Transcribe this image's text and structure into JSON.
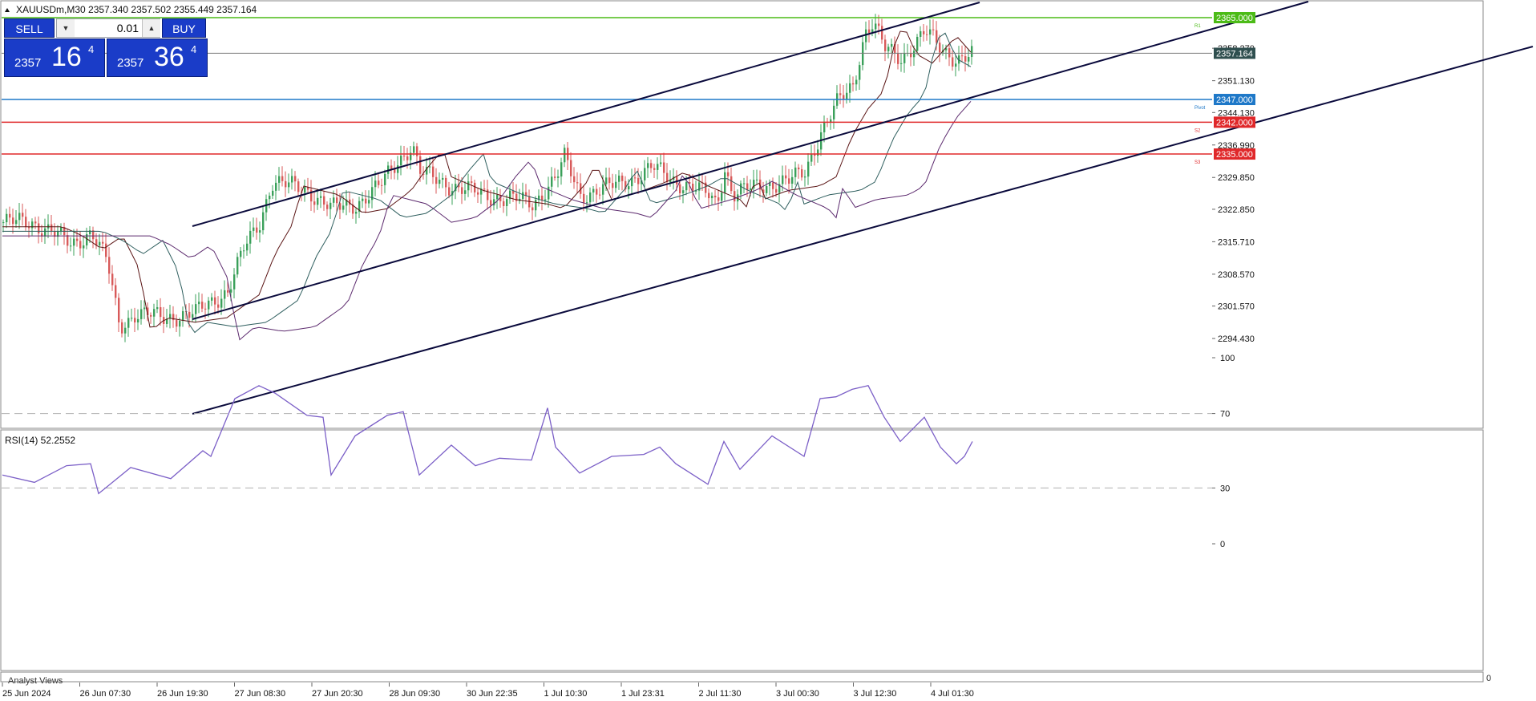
{
  "header": {
    "symbol_line": "XAUUSDm,M30  2357.340 2357.502 2355.449 2357.164"
  },
  "trade_panel": {
    "sell_label": "SELL",
    "buy_label": "BUY",
    "lot_value": "0.01",
    "sell_price_prefix": "2357",
    "sell_price_big": "16",
    "sell_price_sup": "4",
    "buy_price_prefix": "2357",
    "buy_price_big": "36",
    "buy_price_sup": "4"
  },
  "price_axis": {
    "ticks": [
      "2358.270",
      "2351.130",
      "2344.130",
      "2336.990",
      "2329.850",
      "2322.850",
      "2315.710",
      "2308.570",
      "2301.570",
      "2294.430"
    ],
    "tick_values": [
      2358.27,
      2351.13,
      2344.13,
      2336.99,
      2329.85,
      2322.85,
      2315.71,
      2308.57,
      2301.57,
      2294.43
    ]
  },
  "levels": [
    {
      "label": "2365.000",
      "value": 2365.0,
      "tag": "R1",
      "color": "#4cbb17"
    },
    {
      "label": "2347.000",
      "value": 2347.0,
      "tag": "Pivot",
      "color": "#1e78c8"
    },
    {
      "label": "2342.000",
      "value": 2342.0,
      "tag": "S2",
      "color": "#e0282a"
    },
    {
      "label": "2335.000",
      "value": 2335.0,
      "tag": "S3",
      "color": "#e0282a"
    }
  ],
  "current_price": {
    "label": "2357.164",
    "value": 2357.164,
    "color": "#2f4f4f"
  },
  "rsi": {
    "label": "RSI(14) 52.2552",
    "levels": [
      "100",
      "70",
      "30",
      "0"
    ],
    "level_values": [
      100,
      70,
      30,
      0
    ]
  },
  "time_axis": {
    "labels": [
      "25 Jun 2024",
      "26 Jun 07:30",
      "26 Jun 19:30",
      "27 Jun 08:30",
      "27 Jun 20:30",
      "28 Jun 09:30",
      "30 Jun 22:35",
      "1 Jul 10:30",
      "1 Jul 23:31",
      "2 Jul 11:30",
      "3 Jul 00:30",
      "3 Jul 12:30",
      "4 Jul 01:30"
    ]
  },
  "bottom_panel": {
    "label": "Analyst Views",
    "scale_label": "0"
  },
  "colors": {
    "bull": "#3aa05a",
    "bear": "#d85a5a",
    "rsi_line": "#7b5fc7",
    "channel": "#0a0a3c",
    "panel_button": "#1a3cc8"
  }
}
